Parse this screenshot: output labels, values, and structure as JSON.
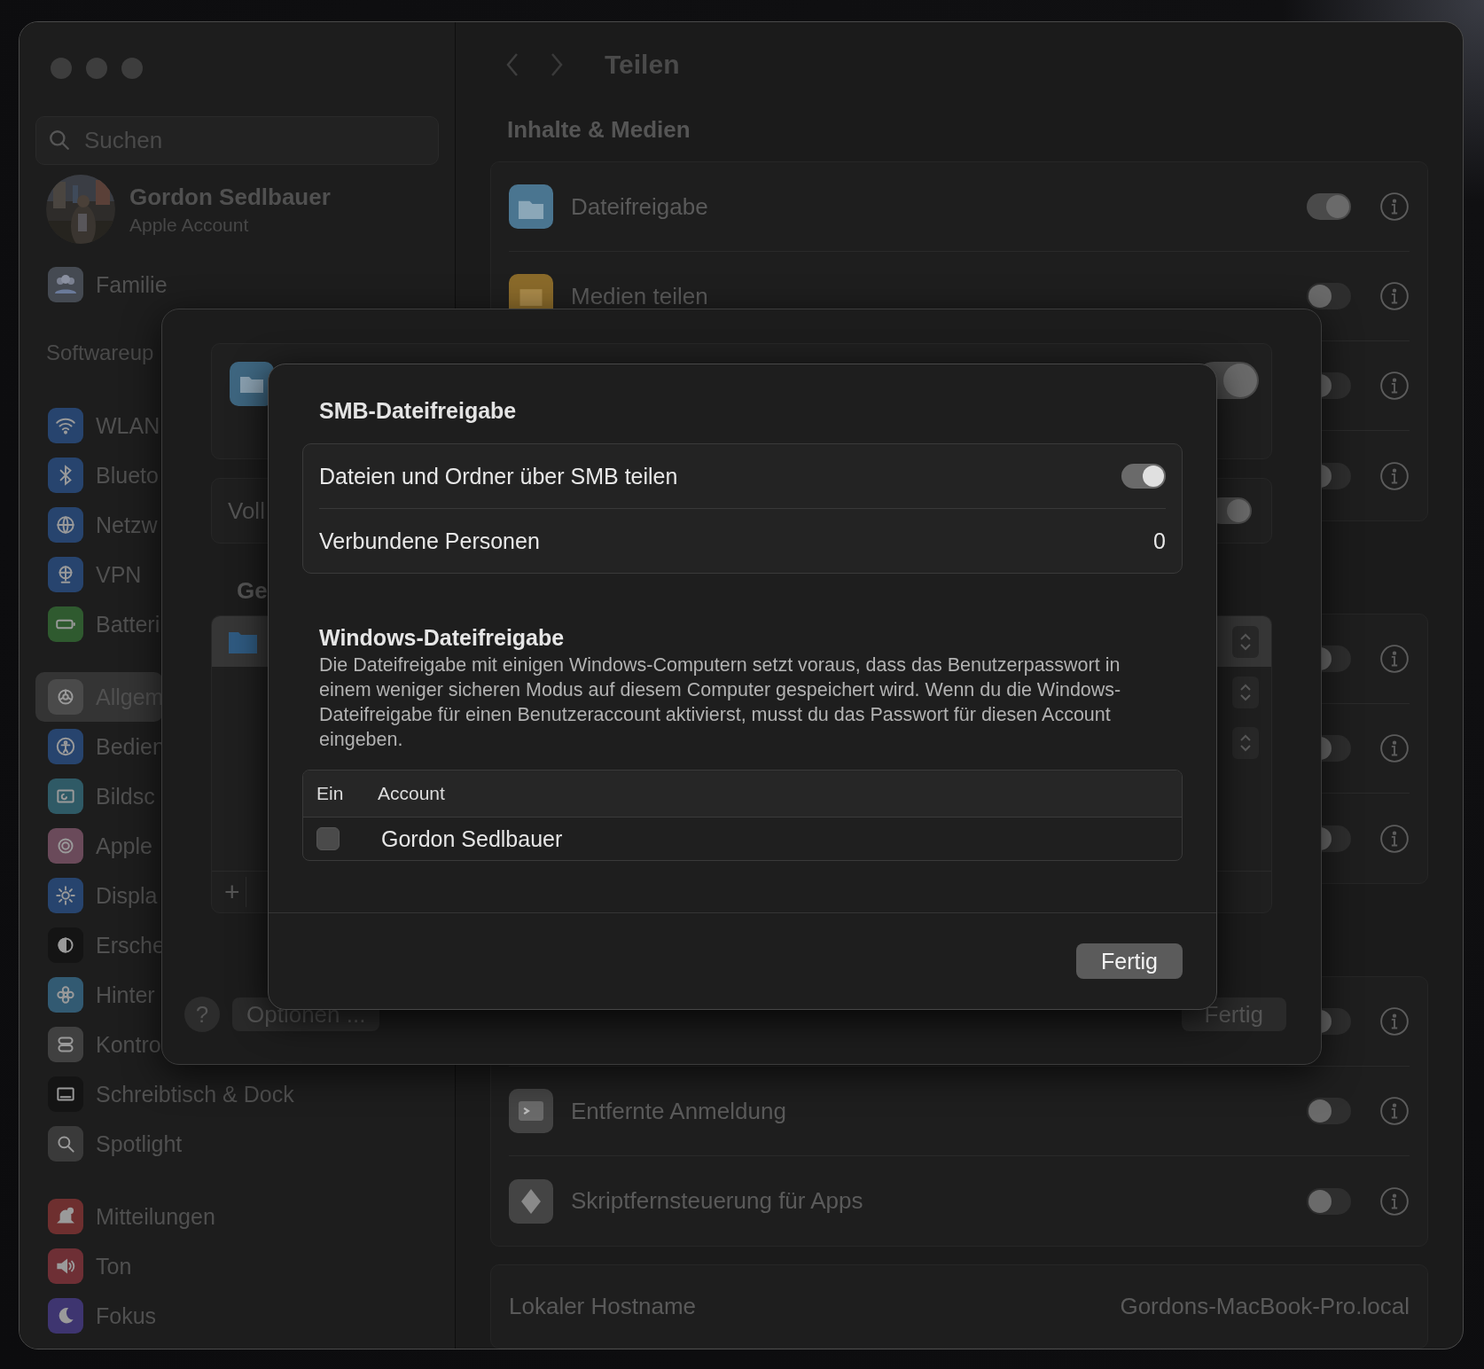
{
  "sidebar": {
    "search": {
      "placeholder": "Suchen"
    },
    "account": {
      "name": "Gordon Sedlbauer",
      "subtitle": "Apple Account"
    },
    "family": {
      "label": "Familie"
    },
    "notice": "Softwareup",
    "groups": [
      {
        "items": [
          {
            "label": "WLAN",
            "color": "#27446e",
            "selected": false
          },
          {
            "label": "Blueto",
            "color": "#27446e",
            "selected": false
          },
          {
            "label": "Netzw",
            "color": "#27446e",
            "selected": false
          },
          {
            "label": "VPN",
            "color": "#27446e",
            "selected": false
          },
          {
            "label": "Batteri",
            "color": "#2f5a2f",
            "selected": false
          }
        ]
      },
      {
        "items": [
          {
            "label": "Allgem",
            "color": "#4a4a4a",
            "selected": true
          },
          {
            "label": "Bedien",
            "color": "#27446e",
            "selected": false
          },
          {
            "label": "Bildsc",
            "color": "#2f5a66",
            "selected": false
          },
          {
            "label": "Apple",
            "color": "#6a4a5a",
            "selected": false
          },
          {
            "label": "Displa",
            "color": "#27446e",
            "selected": false
          },
          {
            "label": "Ersche",
            "color": "#141414",
            "selected": false
          },
          {
            "label": "Hinter",
            "color": "#325a72",
            "selected": false
          },
          {
            "label": "Kontro",
            "color": "#404040",
            "selected": false
          },
          {
            "label": "Schreibtisch & Dock",
            "color": "#141414",
            "selected": false
          },
          {
            "label": "Spotlight",
            "color": "#3a3a3a",
            "selected": false
          }
        ]
      },
      {
        "items": [
          {
            "label": "Mitteilungen",
            "color": "#6e2f2f",
            "selected": false
          },
          {
            "label": "Ton",
            "color": "#6e2f35",
            "selected": false
          },
          {
            "label": "Fokus",
            "color": "#3e3570",
            "selected": false
          }
        ]
      }
    ]
  },
  "main": {
    "title": "Teilen",
    "sections": [
      {
        "header": "Inhalte & Medien",
        "rows": [
          {
            "label": "Dateifreigabe",
            "color": "#4a7590",
            "on": true
          },
          {
            "label": "Medien teilen",
            "color": "#8a6a2a",
            "on": false
          },
          {
            "on": false
          },
          {
            "on": false
          }
        ]
      },
      {
        "rows": [
          {
            "on": false
          },
          {
            "on": false
          },
          {
            "on": false
          }
        ]
      },
      {
        "rows": [
          {
            "on": false
          },
          {
            "label": "Entfernte Anmeldung",
            "color": "#444444",
            "on": false
          },
          {
            "label": "Skriptfernsteuerung für Apps",
            "color": "#444444",
            "on": false
          }
        ]
      }
    ],
    "hostname": {
      "label": "Lokaler Hostname",
      "value": "Gordons-MacBook-Pro.local"
    }
  },
  "sharing_sheet": {
    "main_toggle_on": true,
    "full_access": {
      "label": "Voll",
      "on": true
    },
    "folders_header": "Ge",
    "folders": [
      {
        "selected": true
      },
      {
        "selected": false
      },
      {
        "selected": false
      }
    ],
    "add_button": "+",
    "help_button": "?",
    "options_button": "Optionen ...",
    "done_button": "Fertig"
  },
  "smb_dialog": {
    "title": "SMB-Dateifreigabe",
    "share_row": {
      "label": "Dateien und Ordner über SMB teilen",
      "on": true
    },
    "connected_row": {
      "label": "Verbundene Personen",
      "value": "0"
    },
    "windows_title": "Windows-Dateifreigabe",
    "windows_text": "Die Dateifreigabe mit einigen Windows-Computern setzt voraus, dass das Benutzerpasswort in einem weniger sicheren Modus auf diesem Computer gespeichert wird. Wenn du die Windows-Dateifreigabe für einen Benutzeraccount aktivierst, musst du das Passwort für diesen Account eingeben.",
    "table": {
      "columns": [
        "Ein",
        "Account"
      ],
      "rows": [
        {
          "account": "Gordon Sedlbauer",
          "checked": false
        }
      ]
    },
    "done_button": "Fertig"
  }
}
